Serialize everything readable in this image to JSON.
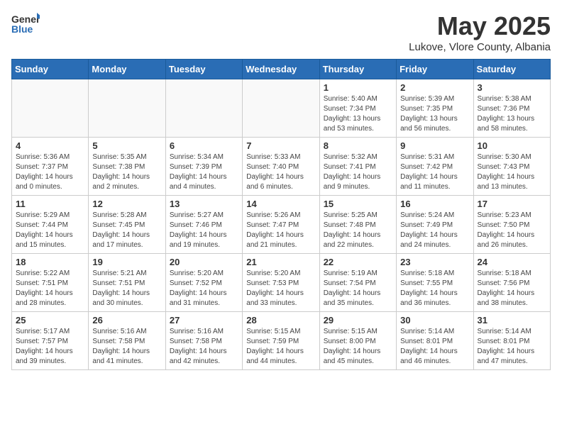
{
  "header": {
    "logo_general": "General",
    "logo_blue": "Blue",
    "title": "May 2025",
    "subtitle": "Lukove, Vlore County, Albania"
  },
  "days_of_week": [
    "Sunday",
    "Monday",
    "Tuesday",
    "Wednesday",
    "Thursday",
    "Friday",
    "Saturday"
  ],
  "weeks": [
    [
      {
        "day": "",
        "info": ""
      },
      {
        "day": "",
        "info": ""
      },
      {
        "day": "",
        "info": ""
      },
      {
        "day": "",
        "info": ""
      },
      {
        "day": "1",
        "info": "Sunrise: 5:40 AM\nSunset: 7:34 PM\nDaylight: 13 hours\nand 53 minutes."
      },
      {
        "day": "2",
        "info": "Sunrise: 5:39 AM\nSunset: 7:35 PM\nDaylight: 13 hours\nand 56 minutes."
      },
      {
        "day": "3",
        "info": "Sunrise: 5:38 AM\nSunset: 7:36 PM\nDaylight: 13 hours\nand 58 minutes."
      }
    ],
    [
      {
        "day": "4",
        "info": "Sunrise: 5:36 AM\nSunset: 7:37 PM\nDaylight: 14 hours\nand 0 minutes."
      },
      {
        "day": "5",
        "info": "Sunrise: 5:35 AM\nSunset: 7:38 PM\nDaylight: 14 hours\nand 2 minutes."
      },
      {
        "day": "6",
        "info": "Sunrise: 5:34 AM\nSunset: 7:39 PM\nDaylight: 14 hours\nand 4 minutes."
      },
      {
        "day": "7",
        "info": "Sunrise: 5:33 AM\nSunset: 7:40 PM\nDaylight: 14 hours\nand 6 minutes."
      },
      {
        "day": "8",
        "info": "Sunrise: 5:32 AM\nSunset: 7:41 PM\nDaylight: 14 hours\nand 9 minutes."
      },
      {
        "day": "9",
        "info": "Sunrise: 5:31 AM\nSunset: 7:42 PM\nDaylight: 14 hours\nand 11 minutes."
      },
      {
        "day": "10",
        "info": "Sunrise: 5:30 AM\nSunset: 7:43 PM\nDaylight: 14 hours\nand 13 minutes."
      }
    ],
    [
      {
        "day": "11",
        "info": "Sunrise: 5:29 AM\nSunset: 7:44 PM\nDaylight: 14 hours\nand 15 minutes."
      },
      {
        "day": "12",
        "info": "Sunrise: 5:28 AM\nSunset: 7:45 PM\nDaylight: 14 hours\nand 17 minutes."
      },
      {
        "day": "13",
        "info": "Sunrise: 5:27 AM\nSunset: 7:46 PM\nDaylight: 14 hours\nand 19 minutes."
      },
      {
        "day": "14",
        "info": "Sunrise: 5:26 AM\nSunset: 7:47 PM\nDaylight: 14 hours\nand 21 minutes."
      },
      {
        "day": "15",
        "info": "Sunrise: 5:25 AM\nSunset: 7:48 PM\nDaylight: 14 hours\nand 22 minutes."
      },
      {
        "day": "16",
        "info": "Sunrise: 5:24 AM\nSunset: 7:49 PM\nDaylight: 14 hours\nand 24 minutes."
      },
      {
        "day": "17",
        "info": "Sunrise: 5:23 AM\nSunset: 7:50 PM\nDaylight: 14 hours\nand 26 minutes."
      }
    ],
    [
      {
        "day": "18",
        "info": "Sunrise: 5:22 AM\nSunset: 7:51 PM\nDaylight: 14 hours\nand 28 minutes."
      },
      {
        "day": "19",
        "info": "Sunrise: 5:21 AM\nSunset: 7:51 PM\nDaylight: 14 hours\nand 30 minutes."
      },
      {
        "day": "20",
        "info": "Sunrise: 5:20 AM\nSunset: 7:52 PM\nDaylight: 14 hours\nand 31 minutes."
      },
      {
        "day": "21",
        "info": "Sunrise: 5:20 AM\nSunset: 7:53 PM\nDaylight: 14 hours\nand 33 minutes."
      },
      {
        "day": "22",
        "info": "Sunrise: 5:19 AM\nSunset: 7:54 PM\nDaylight: 14 hours\nand 35 minutes."
      },
      {
        "day": "23",
        "info": "Sunrise: 5:18 AM\nSunset: 7:55 PM\nDaylight: 14 hours\nand 36 minutes."
      },
      {
        "day": "24",
        "info": "Sunrise: 5:18 AM\nSunset: 7:56 PM\nDaylight: 14 hours\nand 38 minutes."
      }
    ],
    [
      {
        "day": "25",
        "info": "Sunrise: 5:17 AM\nSunset: 7:57 PM\nDaylight: 14 hours\nand 39 minutes."
      },
      {
        "day": "26",
        "info": "Sunrise: 5:16 AM\nSunset: 7:58 PM\nDaylight: 14 hours\nand 41 minutes."
      },
      {
        "day": "27",
        "info": "Sunrise: 5:16 AM\nSunset: 7:58 PM\nDaylight: 14 hours\nand 42 minutes."
      },
      {
        "day": "28",
        "info": "Sunrise: 5:15 AM\nSunset: 7:59 PM\nDaylight: 14 hours\nand 44 minutes."
      },
      {
        "day": "29",
        "info": "Sunrise: 5:15 AM\nSunset: 8:00 PM\nDaylight: 14 hours\nand 45 minutes."
      },
      {
        "day": "30",
        "info": "Sunrise: 5:14 AM\nSunset: 8:01 PM\nDaylight: 14 hours\nand 46 minutes."
      },
      {
        "day": "31",
        "info": "Sunrise: 5:14 AM\nSunset: 8:01 PM\nDaylight: 14 hours\nand 47 minutes."
      }
    ]
  ]
}
